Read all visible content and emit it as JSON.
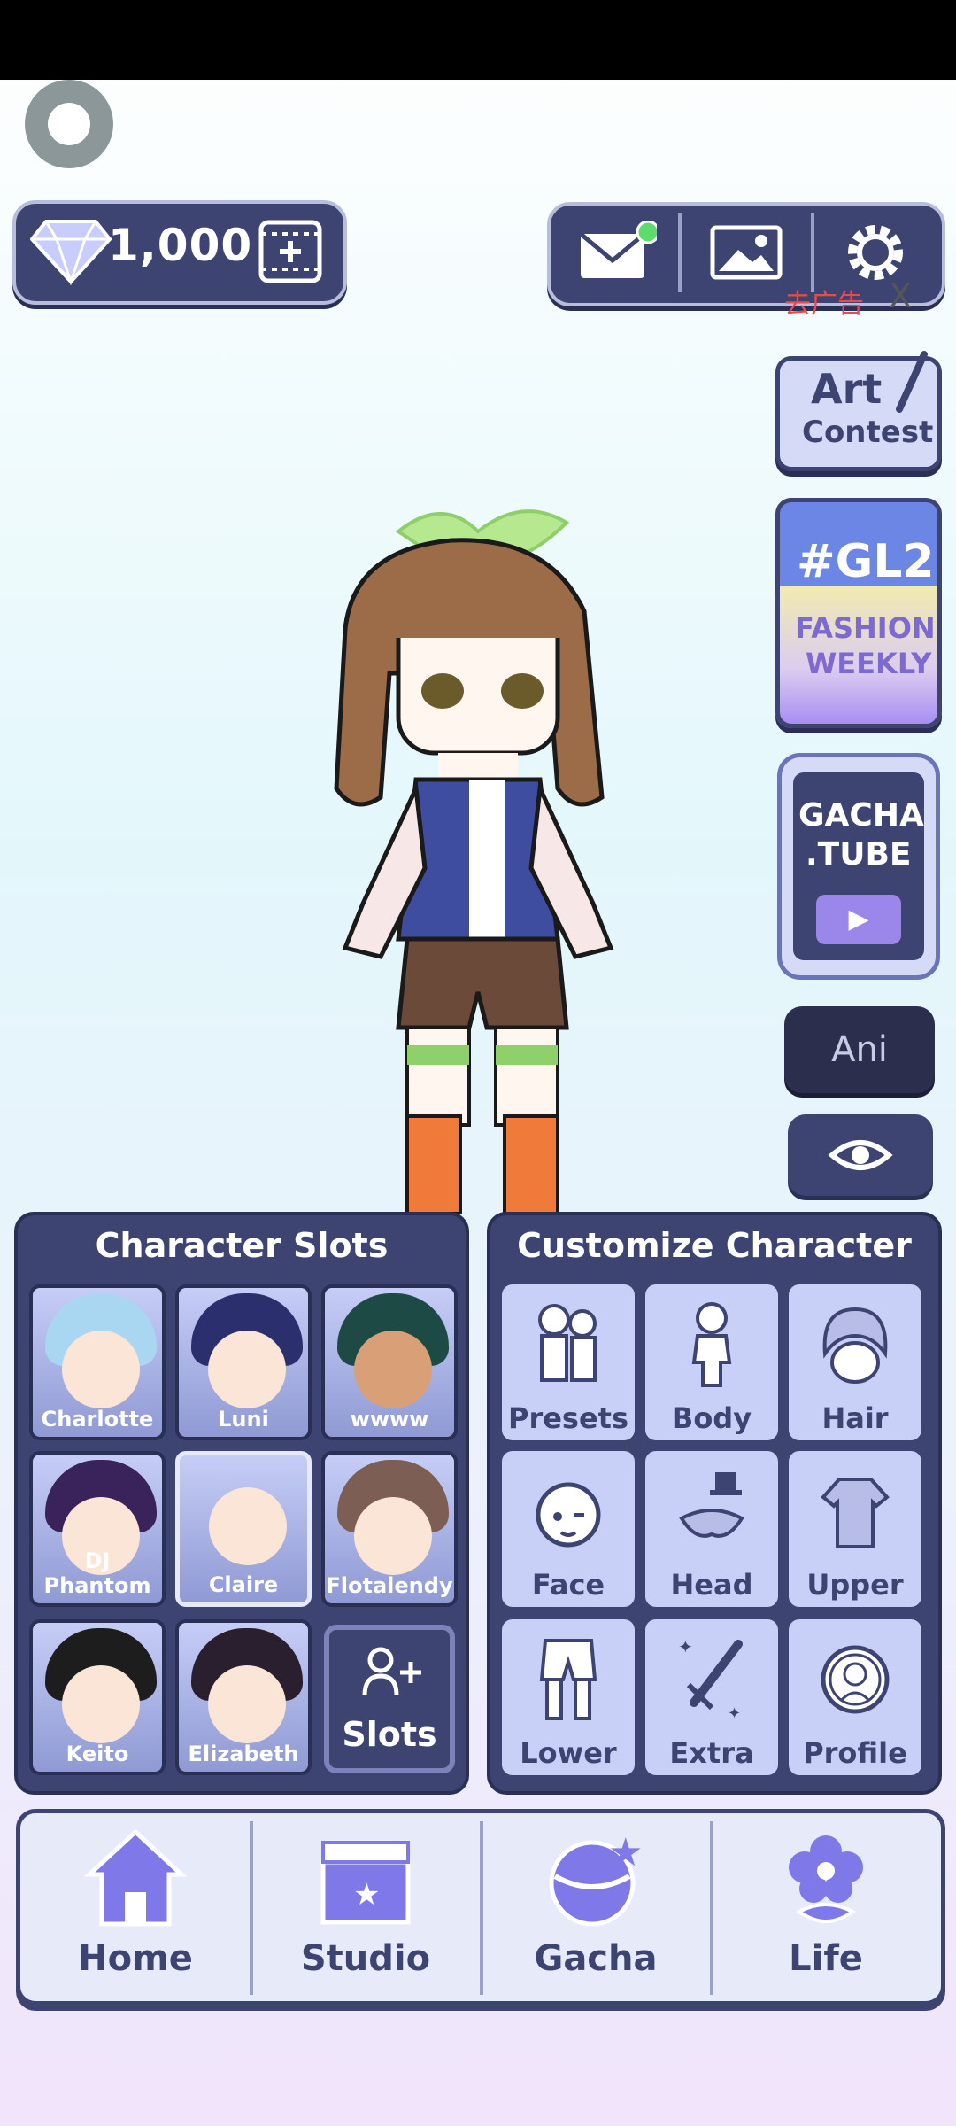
{
  "currency": {
    "gems": "1,000"
  },
  "ad_banner": {
    "label": "去广告",
    "close": "X"
  },
  "side": {
    "art_contest": [
      "Art",
      "Contest"
    ],
    "fashion": {
      "tag": "#GL2",
      "line1": "FASHION",
      "line2": "WEEKLY"
    },
    "gacha_tube": [
      "GACHA",
      ".TUBE"
    ],
    "ani": "Ani"
  },
  "slots": {
    "title": "Character Slots",
    "items": [
      {
        "name": "Charlotte",
        "hair": "#a9d6f0"
      },
      {
        "name": "Luni",
        "hair": "#2c2f6e"
      },
      {
        "name": "wwww",
        "hair": "#1e4a46"
      },
      {
        "name": "DJ Phantom",
        "hair": "#3a225a"
      },
      {
        "name": "Claire",
        "hair": "#f3d2c0"
      },
      {
        "name": "Flotalendy",
        "hair": "#7c5e55"
      },
      {
        "name": "Keito",
        "hair": "#1d1d1d"
      },
      {
        "name": "Elizabeth",
        "hair": "#2a1f2e"
      }
    ],
    "add_label": "Slots"
  },
  "customize": {
    "title": "Customize Character",
    "items": [
      "Presets",
      "Body",
      "Hair",
      "Face",
      "Head",
      "Upper",
      "Lower",
      "Extra",
      "Profile"
    ]
  },
  "nav": [
    "Home",
    "Studio",
    "Gacha",
    "Life"
  ],
  "colors": {
    "panel": "#3e4472",
    "tile": "#c9d0f7",
    "accent": "#5edb6a"
  }
}
